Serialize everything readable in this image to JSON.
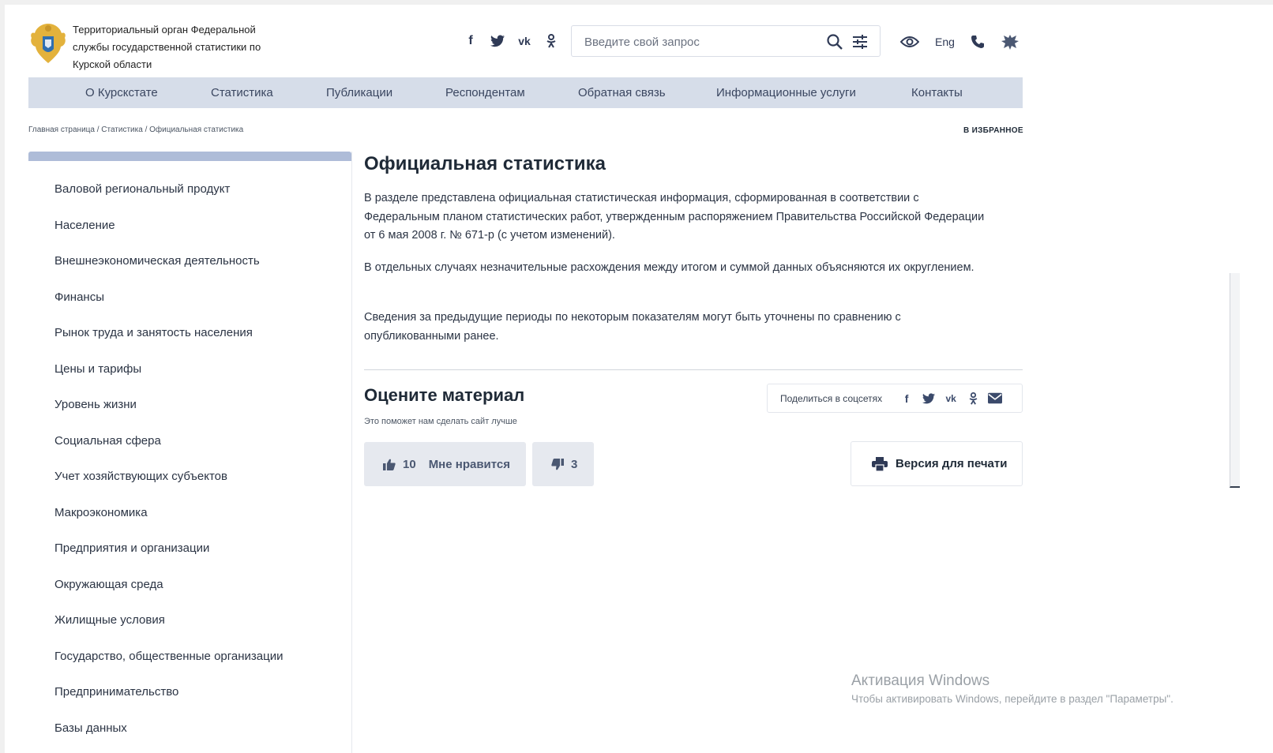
{
  "header": {
    "org_name": "Территориальный орган Федеральной службы государственной статистики по Курской области",
    "search_placeholder": "Введите свой запрос",
    "lang": "Eng",
    "social": [
      "facebook-icon",
      "twitter-icon",
      "vk-icon",
      "odnoklassniki-icon"
    ]
  },
  "nav": {
    "items": [
      "О Курскстате",
      "Статистика",
      "Публикации",
      "Респондентам",
      "Обратная связь",
      "Информационные услуги",
      "Контакты"
    ]
  },
  "breadcrumb": "Главная страница / Статистика / Официальная статистика",
  "favorite_label": "В ИЗБРАННОЕ",
  "sidebar": {
    "items": [
      "Валовой региональный продукт",
      "Население",
      "Внешнеэкономическая деятельность",
      "Финансы",
      "Рынок труда и занятость населения",
      "Цены и тарифы",
      "Уровень жизни",
      "Социальная сфера",
      "Учет хозяйствующих субъектов",
      "Макроэкономика",
      "Предприятия и организации",
      "Окружающая среда",
      "Жилищные условия",
      "Государство, общественные организации",
      "Предпринимательство",
      "Базы данных"
    ]
  },
  "main": {
    "title": "Официальная статистика",
    "paragraphs": [
      "В разделе представлена официальная статистическая информация, сформированная в соответствии с Федеральным планом статистических работ, утвержденным распоряжением Правительства Российской Федерации от 6 мая 2008 г. № 671-р (с учетом изменений).",
      "В отдельных случаях незначительные расхождения между итогом и суммой данных объясняются их округлением.",
      "Сведения за предыдущие периоды по некоторым показателям могут быть уточнены по сравнению с опубликованными ранее."
    ]
  },
  "rating": {
    "title": "Оцените материал",
    "subtitle": "Это поможет нам сделать сайт лучше",
    "like_count": "10",
    "like_label": "Мне нравится",
    "dislike_count": "3",
    "share_label": "Поделиться в соцсетях",
    "print_label": "Версия для печати"
  },
  "watermark": {
    "title": "Активация Windows",
    "text": "Чтобы активировать Windows, перейдите в раздел \"Параметры\"."
  },
  "colors": {
    "nav_bg": "#d6dde9",
    "sidebar_bar": "#aebcd8",
    "button_bg": "#e6e9ef",
    "text_dark": "#1f2a37"
  }
}
